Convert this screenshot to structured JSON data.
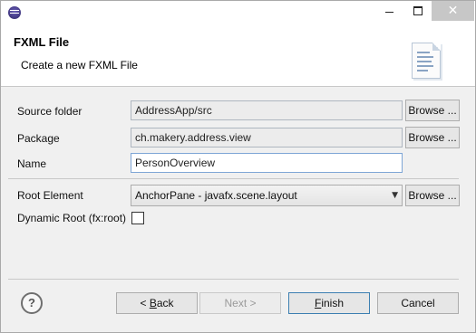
{
  "titlebar": {
    "minimize_icon": "minimize-icon",
    "maximize_icon": "maximize-icon",
    "close_glyph": "✕"
  },
  "header": {
    "title": "FXML File",
    "subtitle": "Create a new FXML File"
  },
  "form": {
    "source_folder": {
      "label": "Source folder",
      "value": "AddressApp/src",
      "browse_label": "Browse ..."
    },
    "package": {
      "label": "Package",
      "value": "ch.makery.address.view",
      "browse_label": "Browse ..."
    },
    "name": {
      "label": "Name",
      "value": "PersonOverview"
    },
    "root_element": {
      "label": "Root Element",
      "value": "AnchorPane - javafx.scene.layout",
      "browse_label": "Browse ..."
    },
    "dynamic_root": {
      "label": "Dynamic Root (fx:root)",
      "checked": false
    }
  },
  "footer": {
    "help_glyph": "?",
    "back_label": "< Back",
    "back_mnemonic_prefix": "< ",
    "back_mnemonic": "B",
    "back_rest": "ack",
    "next_label": "Next >",
    "finish_mnemonic": "F",
    "finish_rest": "inish",
    "cancel_label": "Cancel"
  }
}
